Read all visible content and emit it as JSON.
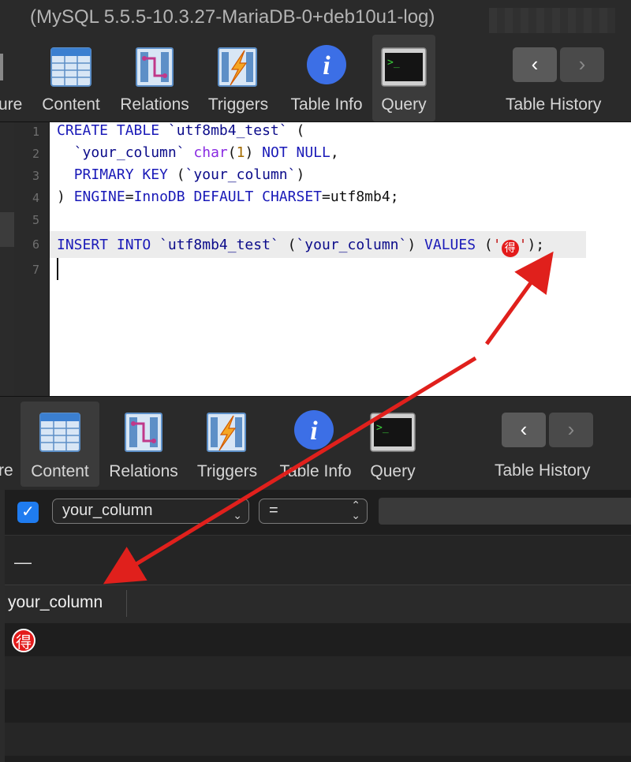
{
  "window": {
    "title": "(MySQL 5.5.5-10.3.27-MariaDB-0+deb10u1-log)"
  },
  "toolbar_top": {
    "partial_label": "ure",
    "items": [
      {
        "label": "Content",
        "icon": "table-grid-icon"
      },
      {
        "label": "Relations",
        "icon": "relations-icon"
      },
      {
        "label": "Triggers",
        "icon": "triggers-icon"
      },
      {
        "label": "Table Info",
        "icon": "info-icon"
      },
      {
        "label": "Query",
        "icon": "terminal-icon"
      }
    ],
    "history_label": "Table History",
    "back_glyph": "‹",
    "forward_glyph": "›"
  },
  "editor": {
    "line_numbers": [
      "1",
      "2",
      "3",
      "4",
      "5",
      "6",
      "7"
    ],
    "lines": [
      "CREATE TABLE `utf8mb4_test` (",
      "  `your_column` char(1) NOT NULL,",
      "  PRIMARY KEY (`your_column`)",
      ") ENGINE=InnoDB DEFAULT CHARSET=utf8mb4;",
      "",
      "INSERT INTO `utf8mb4_test` (`your_column`) VALUES ('🉐');",
      ""
    ],
    "emoji_char": "得"
  },
  "toolbar_bottom": {
    "partial_label": "re",
    "items": [
      {
        "label": "Content",
        "icon": "table-grid-icon"
      },
      {
        "label": "Relations",
        "icon": "relations-icon"
      },
      {
        "label": "Triggers",
        "icon": "triggers-icon"
      },
      {
        "label": "Table Info",
        "icon": "info-icon"
      },
      {
        "label": "Query",
        "icon": "terminal-icon"
      }
    ],
    "history_label": "Table History",
    "back_glyph": "‹",
    "forward_glyph": "›"
  },
  "filter": {
    "checked": true,
    "column_select": "your_column",
    "operator_select": "=",
    "value_placeholder": ""
  },
  "results": {
    "rows_indicator": "—",
    "columns": [
      "your_column"
    ],
    "rows": [
      [
        "得"
      ]
    ]
  },
  "colors": {
    "accent_blue": "#1f7cf0",
    "arrow_red": "#e0201c",
    "keyword": "#1a1ab8"
  }
}
